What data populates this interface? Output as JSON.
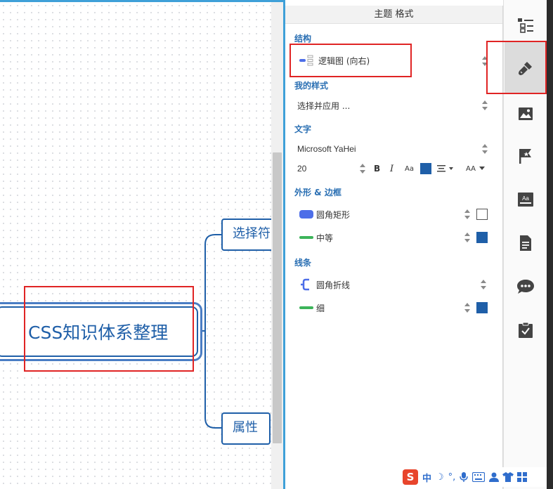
{
  "canvas": {
    "central_topic": "CSS知识体系整理",
    "branches": [
      {
        "label": "选择符"
      },
      {
        "label": "属性"
      }
    ]
  },
  "format_panel": {
    "title": "主题 格式",
    "structure": {
      "section": "结构",
      "value": "逻辑图 (向右)"
    },
    "my_style": {
      "section": "我的样式",
      "value": "选择并应用 ..."
    },
    "text": {
      "section": "文字",
      "font": "Microsoft YaHei",
      "size": "20",
      "bold_label": "B",
      "italic_label": "I",
      "case_label": "Aa",
      "text_color": "#1f5fa8",
      "more_label": "AA"
    },
    "shape_border": {
      "section": "外形 & 边框",
      "shape": "圆角矩形",
      "shape_fill": "#ffffff",
      "border": "中等",
      "border_color": "#1f5fa8"
    },
    "line": {
      "section": "线条",
      "style": "圆角折线",
      "width": "细",
      "line_color": "#1f5fa8"
    }
  },
  "toolbar": {
    "items": [
      {
        "icon": "outline-icon"
      },
      {
        "icon": "format-brush-icon",
        "active": true
      },
      {
        "icon": "image-icon"
      },
      {
        "icon": "flag-icon"
      },
      {
        "icon": "text-style-icon"
      },
      {
        "icon": "notes-icon"
      },
      {
        "icon": "comment-icon"
      },
      {
        "icon": "task-icon"
      }
    ]
  },
  "ime": {
    "logo": "S",
    "mode": "中",
    "moon": "☽",
    "punct": "°,"
  },
  "colors": {
    "accent": "#1f5fa8",
    "canvas_border": "#3fa0d8",
    "highlight": "#e02424",
    "line_green": "#3cb45a",
    "shape_blue": "#4d6ee8"
  }
}
